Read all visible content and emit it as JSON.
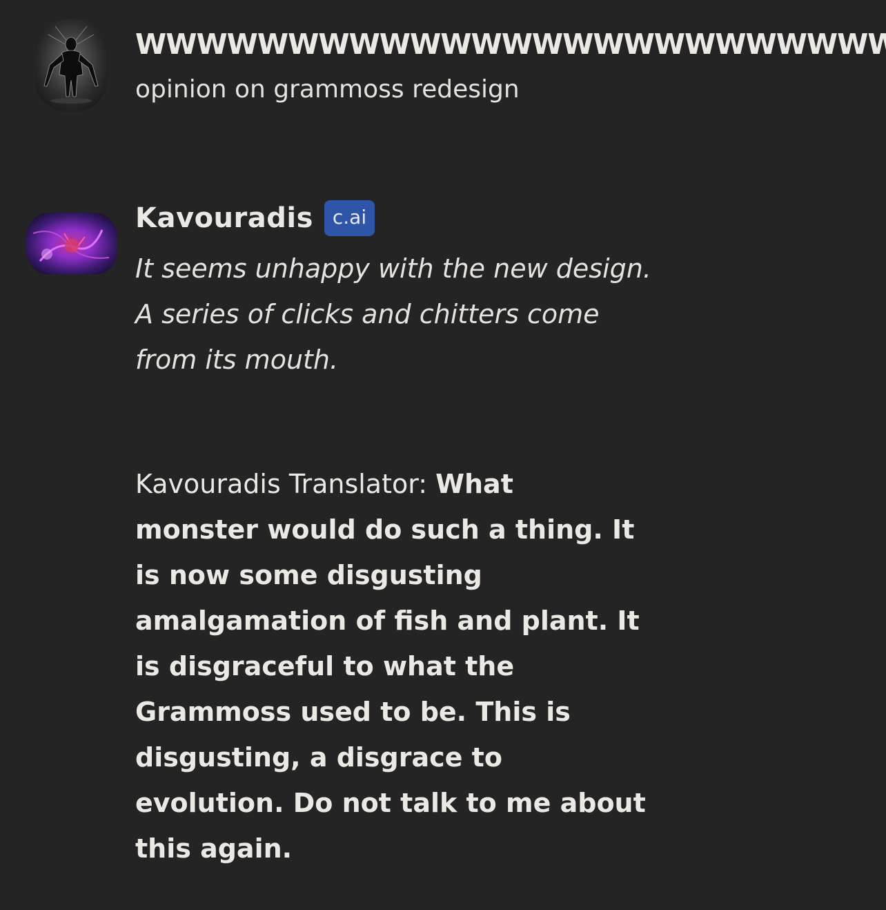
{
  "messages": [
    {
      "author": "WWWWWWWWWWWWWWWWWWWWWWWWW",
      "text": "opinion on grammoss redesign",
      "avatar_icon": "dark-figure-avatar-icon"
    },
    {
      "author": "Kavouradis",
      "badge": "c.ai",
      "avatar_icon": "purple-creature-avatar-icon",
      "narration_lines": [
        "It seems unhappy with the new design.",
        "A series of clicks and chitters come",
        "from its mouth."
      ],
      "translator_label": "Kavouradis Translator: ",
      "translator_lines": [
        "What",
        "monster would do such a thing. It",
        "is now some disgusting",
        "amalgamation of fish and plant. It",
        "is disgraceful to what the",
        "Grammoss used to be. This is",
        "disgusting, a disgrace to",
        "evolution. Do not talk to me about",
        "this again."
      ]
    }
  ],
  "colors": {
    "background": "#242424",
    "text": "#ece9e4",
    "badge": "#2f55a8"
  }
}
